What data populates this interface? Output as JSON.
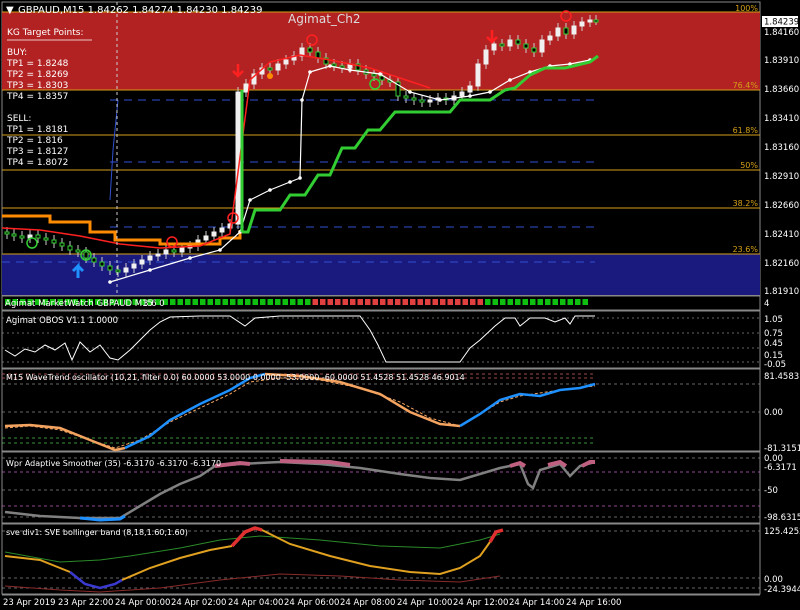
{
  "header": {
    "symbol_info": "GBPAUD,M15  1.84262 1.84274 1.84230 1.84239",
    "indicator_title": "Agimat_Ch2",
    "current_price": "1.84239"
  },
  "kg_panel": {
    "title": "KG Target Points:",
    "buy_label": "BUY:",
    "buy": [
      "TP1 = 1.8248",
      "TP2 = 1.8269",
      "TP3 = 1.8303",
      "TP4 = 1.8357"
    ],
    "sell_label": "SELL:",
    "sell": [
      "TP1 = 1.8181",
      "TP2 = 1.816",
      "TP3 = 1.8127",
      "TP4 = 1.8072"
    ]
  },
  "main_axis": [
    "1.84239",
    "1.84160",
    "1.83910",
    "1.83660",
    "1.83410",
    "1.83160",
    "1.82910",
    "1.82660",
    "1.82410",
    "1.82160",
    "1.81910"
  ],
  "fib_levels": [
    "100%",
    "76.4%",
    "61.8%",
    "50%",
    "38.2%",
    "23.6%"
  ],
  "marketwatch": {
    "label": "Agimat MarketWatch GBPAUD M15",
    "digits": "3 6 0",
    "side_value": "4"
  },
  "obos": {
    "label": "Agimat OBOS V1.1 1.0000",
    "axis": [
      "1.05",
      "0.75",
      "0.45",
      "0.15",
      "-0.05"
    ]
  },
  "wavetrend": {
    "label": "M15 WaveTrend oscillator (10,21, filter 0.0) 60.0000 53.0000 0.0000 -53.0000 -60.0000 51.4528 51.4528 46.9014",
    "axis": [
      "81.4583",
      "0.00",
      "-81.3151"
    ]
  },
  "wpr": {
    "label": "Wpr  Adaptive Smoother (35) -6.3170 -6.3170 -6.3170",
    "axis": [
      "0.00",
      "-6.3171",
      "-50",
      "-98.6315"
    ]
  },
  "sve": {
    "label": "sve div1:  SVE bollinger band (8,18,1.60,1.60)",
    "axis": [
      "125.4252",
      "0.00",
      "-24.3944"
    ]
  },
  "time_axis": [
    "23 Apr 2019",
    "23 Apr 22:00",
    "24 Apr 00:00",
    "24 Apr 02:00",
    "24 Apr 04:00",
    "24 Apr 06:00",
    "24 Apr 08:00",
    "24 Apr 10:00",
    "24 Apr 12:00",
    "24 Apr 14:00",
    "24 Apr 16:00"
  ],
  "colors": {
    "band_red": "#b22222",
    "band_blue": "#1a1a7e",
    "fib_line": "#d4a017",
    "green_step": "#32cd32",
    "orange": "#ff8c00",
    "wt_blue": "#1e90ff",
    "wt_orange": "#f4a460",
    "wpr_pink": "#c06080",
    "sve_red": "#e03030",
    "sve_gold": "#e0a020"
  }
}
